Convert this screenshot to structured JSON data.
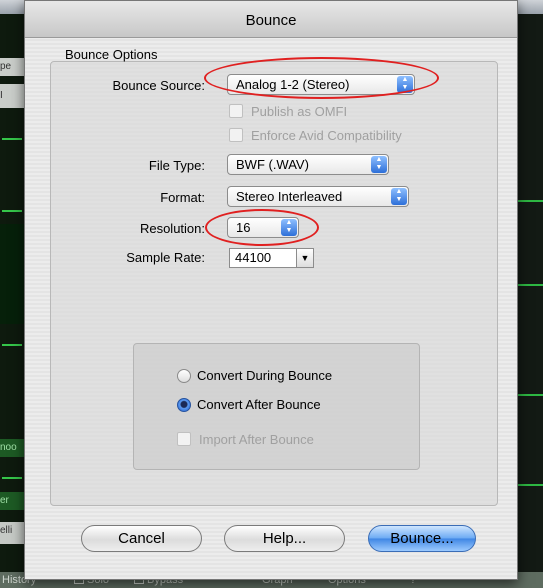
{
  "window": {
    "title": "Bounce"
  },
  "background": {
    "left_labels": [
      "pe",
      "I",
      "noo",
      "er",
      "elli"
    ],
    "bottom_items": [
      "History",
      "Solo",
      "Bypass",
      "Graph",
      "Options",
      "?"
    ]
  },
  "bounce_options": {
    "label": "Bounce Options",
    "bounce_source": {
      "label": "Bounce Source:",
      "value": "Analog 1-2 (Stereo)"
    },
    "publish_omfi": {
      "label": "Publish as OMFI",
      "checked": false,
      "enabled": false
    },
    "enforce_avid": {
      "label": "Enforce Avid Compatibility",
      "checked": false,
      "enabled": false
    },
    "file_type": {
      "label": "File Type:",
      "value": "BWF (.WAV)"
    },
    "format": {
      "label": "Format:",
      "value": "Stereo Interleaved"
    },
    "resolution": {
      "label": "Resolution:",
      "value": "16"
    },
    "sample_rate": {
      "label": "Sample Rate:",
      "value": "44100"
    }
  },
  "convert": {
    "during": {
      "label": "Convert During Bounce",
      "selected": false
    },
    "after": {
      "label": "Convert After Bounce",
      "selected": true
    },
    "import_after": {
      "label": "Import After Bounce",
      "checked": false,
      "enabled": false
    }
  },
  "buttons": {
    "cancel": "Cancel",
    "help": "Help...",
    "bounce": "Bounce..."
  },
  "colors": {
    "annotation": "#e02020",
    "accent": "#3f86e4",
    "meter_green": "#35c64a"
  },
  "icons": {
    "popup_arrows": "updown-arrows-icon",
    "combo_arrow": "chevron-down-icon"
  }
}
